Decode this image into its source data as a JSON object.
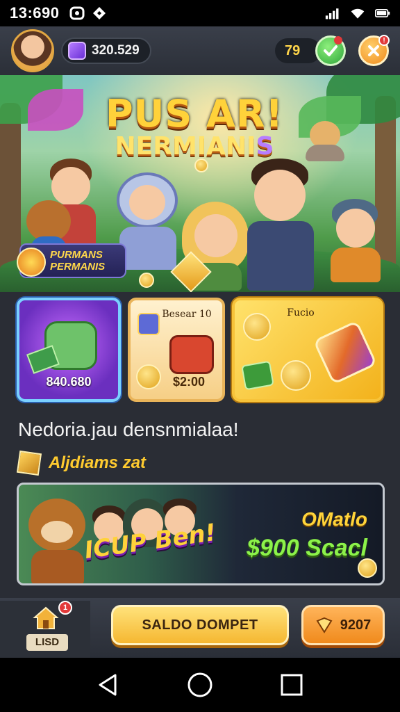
{
  "status_bar": {
    "time": "13:690",
    "icons": [
      "notification-icon",
      "location-icon",
      "signal-icon",
      "wifi-icon",
      "battery-icon"
    ]
  },
  "header": {
    "balance": "320.529",
    "counter": "79",
    "icons": [
      "avatar",
      "gem-icon",
      "check-icon",
      "close-icon"
    ]
  },
  "hero": {
    "title_line1": "PUS AR!",
    "title_line2_main": "NERMIANI",
    "title_line2_end": "S",
    "banner_line1": "PURMANS",
    "banner_line2": "PERMANIS"
  },
  "cards": [
    {
      "label": "",
      "value": "840.680"
    },
    {
      "label": "Besear 10",
      "value": "$2:00"
    },
    {
      "label": "Fucio",
      "value": ""
    }
  ],
  "message": {
    "headline": "Nedoria.jau densnmialaa!",
    "subheading": "Aljdiams zat"
  },
  "promo": {
    "logo_text": "ICUP Ben!",
    "line1": "OMatlo",
    "line2": "$900 Scacl"
  },
  "action_bar": {
    "home_label": "LISD",
    "home_badge": "1",
    "saldo_button": "SALDO DOMPET",
    "coins_value": "9207"
  },
  "nav": [
    "back-icon",
    "home-circle-icon",
    "recents-icon"
  ],
  "colors": {
    "accent_gold": "#ffd23a",
    "accent_green": "#8cf24a",
    "panel_bg": "#2a2d35"
  }
}
